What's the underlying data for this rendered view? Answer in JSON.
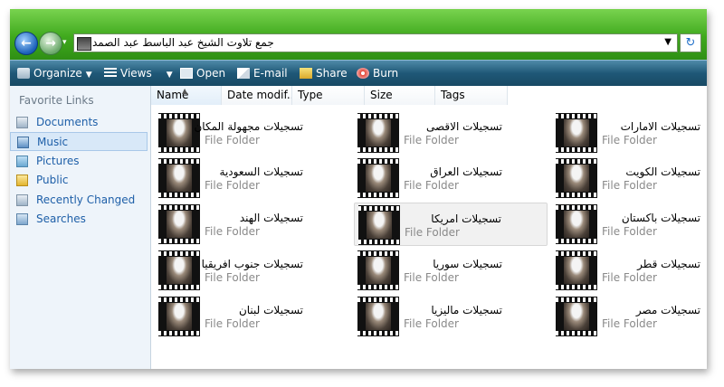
{
  "address": {
    "path": "جمع تلاوت الشيخ عبد الباسط عبد الصمد"
  },
  "toolbar": {
    "organize": "Organize",
    "views": "Views",
    "open": "Open",
    "email": "E-mail",
    "share": "Share",
    "burn": "Burn"
  },
  "sidebar": {
    "title": "Favorite Links",
    "items": [
      {
        "label": "Documents",
        "icon": "documents-icon"
      },
      {
        "label": "Music",
        "icon": "music-icon",
        "selected": true
      },
      {
        "label": "Pictures",
        "icon": "pictures-icon"
      },
      {
        "label": "Public",
        "icon": "public-folder-icon"
      },
      {
        "label": "Recently Changed",
        "icon": "recently-changed-icon"
      },
      {
        "label": "Searches",
        "icon": "searches-icon"
      }
    ]
  },
  "columns": [
    "Name",
    "Date modif...",
    "Type",
    "Size",
    "Tags"
  ],
  "files": [
    {
      "name": "تسجيلات مجهولة المكان",
      "type": "File Folder"
    },
    {
      "name": "تسجيلات الاقصى",
      "type": "File Folder"
    },
    {
      "name": "تسجيلات الامارات",
      "type": "File Folder"
    },
    {
      "name": "تسجيلات السعودية",
      "type": "File Folder"
    },
    {
      "name": "تسجيلات العراق",
      "type": "File Folder"
    },
    {
      "name": "تسجيلات الكويت",
      "type": "File Folder"
    },
    {
      "name": "تسجيلات الهند",
      "type": "File Folder"
    },
    {
      "name": "تسجيلات امريكا",
      "type": "File Folder"
    },
    {
      "name": "تسجيلات باكستان",
      "type": "File Folder"
    },
    {
      "name": "تسجيلات جنوب افريقيا",
      "type": "File Folder"
    },
    {
      "name": "تسجيلات سوريا",
      "type": "File Folder"
    },
    {
      "name": "تسجيلات قطر",
      "type": "File Folder"
    },
    {
      "name": "تسجيلات لبنان",
      "type": "File Folder"
    },
    {
      "name": "تسجيلات ماليزيا",
      "type": "File Folder"
    },
    {
      "name": "تسجيلات مصر",
      "type": "File Folder"
    }
  ],
  "colors": {
    "frame": "#5fc23d",
    "toolbar": "#1f5877",
    "link": "#1e5fa8"
  }
}
